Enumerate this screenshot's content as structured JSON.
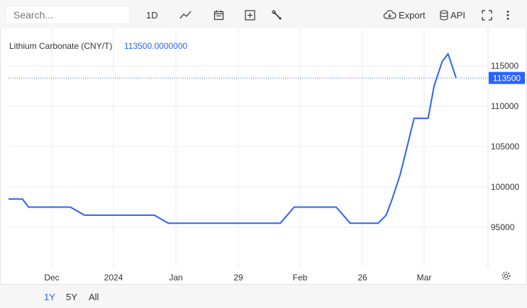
{
  "toolbar": {
    "search_placeholder": "Search...",
    "interval_label": "1D",
    "export_label": "Export",
    "api_label": "API",
    "icons": [
      "line-chart-icon",
      "calendar-icon",
      "add-indicator-icon",
      "wrench-icon",
      "cloud-download-icon",
      "database-icon",
      "fullscreen-icon",
      "more-vertical-icon"
    ]
  },
  "legend": {
    "name": "Lithium Carbonate (CNY/T)",
    "value": "113500.0000000"
  },
  "price_tag": "113500",
  "ranges": [
    {
      "label": "1Y",
      "active": true
    },
    {
      "label": "5Y",
      "active": false
    },
    {
      "label": "All",
      "active": false
    }
  ],
  "colors": {
    "line": "#2962ff",
    "grid": "#eeeeee",
    "toolbar_bg": "#f6f6f6",
    "active_range": "#2962ff"
  },
  "chart_data": {
    "type": "line",
    "title": "Lithium Carbonate (CNY/T)",
    "xlabel": "",
    "ylabel": "",
    "x_ticks": [
      "Dec",
      "2024",
      "Jan",
      "29",
      "Feb",
      "26",
      "Mar"
    ],
    "y_ticks": [
      95000,
      100000,
      105000,
      110000,
      115000
    ],
    "ylim": [
      90000,
      117500
    ],
    "last_value": 113500,
    "grid": true,
    "series": [
      {
        "color": "#2962ff",
        "x": [
          "2023-10-16",
          "2023-10-23",
          "2023-10-26",
          "2023-11-02",
          "2023-11-09",
          "2023-11-16",
          "2023-11-23",
          "2023-11-30",
          "2023-12-07",
          "2023-12-14",
          "2023-12-21",
          "2023-12-28",
          "2024-01-04",
          "2024-01-11",
          "2024-01-18",
          "2024-01-25",
          "2024-02-01",
          "2024-02-08",
          "2024-02-15",
          "2024-02-22",
          "2024-02-29",
          "2024-03-07",
          "2024-03-14",
          "2024-03-21",
          "2024-03-28",
          "2024-04-04",
          "2024-04-11",
          "2024-04-18",
          "2024-04-22",
          "2024-04-25",
          "2024-04-29",
          "2024-05-02",
          "2024-05-06",
          "2024-05-09",
          "2024-05-13",
          "2024-05-16",
          "2024-05-20",
          "2024-05-23",
          "2024-05-27"
        ],
        "values": [
          98500,
          98500,
          97500,
          97500,
          97500,
          97500,
          96500,
          96500,
          96500,
          96500,
          96500,
          96500,
          95500,
          95500,
          95500,
          95500,
          95500,
          95500,
          95500,
          95500,
          95500,
          97500,
          97500,
          97500,
          97500,
          95500,
          95500,
          95500,
          96500,
          98500,
          101500,
          104500,
          108500,
          108500,
          108500,
          112500,
          115500,
          116500,
          113500
        ]
      }
    ]
  }
}
